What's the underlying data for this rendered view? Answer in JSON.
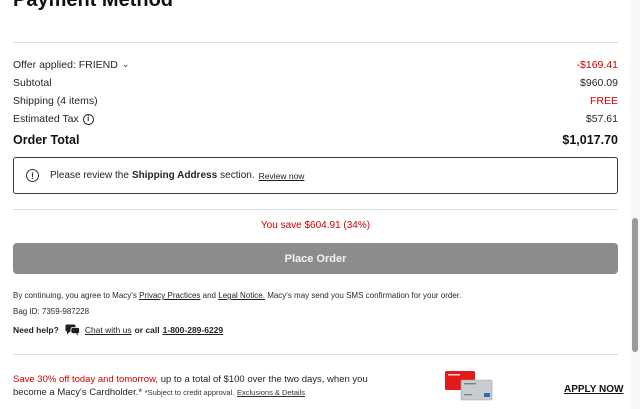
{
  "section": {
    "title": "Payment Method"
  },
  "summary": {
    "offer": {
      "label": "Offer applied: FRIEND",
      "value": "-$169.41"
    },
    "subtotal": {
      "label": "Subtotal",
      "value": "$960.09"
    },
    "shipping": {
      "label": "Shipping (4 items)",
      "value": "FREE"
    },
    "tax": {
      "label": "Estimated Tax",
      "value": "$57.61"
    },
    "total": {
      "label": "Order Total",
      "value": "$1,017.70"
    }
  },
  "alert": {
    "pre": "Please review the",
    "bold": "Shipping Address",
    "post": "section.",
    "link": "Review now"
  },
  "savings": "You save $604.91 (34%)",
  "place_order": "Place Order",
  "legal": {
    "pre": "By continuing, you agree to Macy's",
    "privacy": "Privacy Practices",
    "and": "and",
    "notice": "Legal Notice.",
    "post": "Macy's may send you SMS confirmation for your order."
  },
  "bag_id": "Bag ID: 7359-987228",
  "help": {
    "need": "Need help?",
    "chat": "Chat with us",
    "or": "or call",
    "phone": "1-800-289-6229"
  },
  "promo": {
    "highlight": "Save 30% off today and tomorrow,",
    "text1": "up to a total of $100 over the two days, when you",
    "text2": "become a Macy's Cardholder.*",
    "subject": "*Subject to credit approval.",
    "exclusions": "Exclusions & Details",
    "apply": "APPLY NOW"
  },
  "colors": {
    "accent_red": "#cc0000",
    "button_disabled": "#8c8c8c"
  }
}
